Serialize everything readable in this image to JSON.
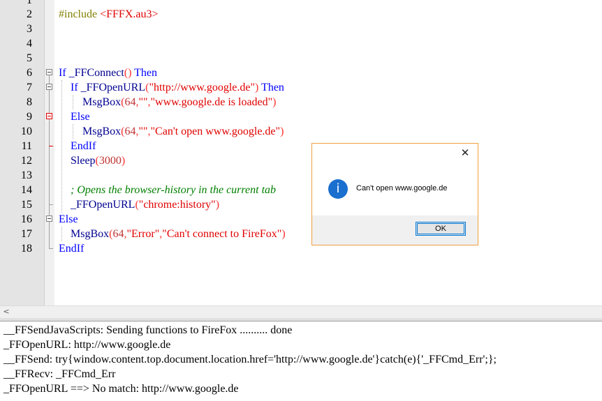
{
  "editor": {
    "line_numbers": [
      "1",
      "2",
      "3",
      "4",
      "5",
      "6",
      "7",
      "8",
      "9",
      "10",
      "11",
      "12",
      "13",
      "14",
      "15",
      "16",
      "17",
      "18"
    ],
    "code": {
      "l2_directive": "#include ",
      "l2_include": "<FFFX.au3>",
      "l6_if": "If ",
      "l6_fn": "_FFConnect",
      "l6_parens": "()",
      "l6_then": " Then",
      "l7_if": "If ",
      "l7_fn": "_FFOpenURL",
      "l7_open": "(",
      "l7_str": "\"http://www.google.de\"",
      "l7_close": ")",
      "l7_then": " Then",
      "l8_fn": "MsgBox",
      "l8_open": "(",
      "l8_num": "64",
      "l8_comma1": ",",
      "l8_str1": "\"\"",
      "l8_comma2": ",",
      "l8_str2": "\"www.google.de is loaded\"",
      "l8_close": ")",
      "l9_else": "Else",
      "l10_fn": "MsgBox",
      "l10_open": "(",
      "l10_num": "64",
      "l10_comma1": ",",
      "l10_str1": "\"\"",
      "l10_comma2": ",",
      "l10_str2": "\"Can't open www.google.de\"",
      "l10_close": ")",
      "l11_endif": "EndIf",
      "l12_fn": "Sleep",
      "l12_open": "(",
      "l12_num": "3000",
      "l12_close": ")",
      "l14_comment": "; Opens the browser-history in the current tab",
      "l15_fn": "_FFOpenURL",
      "l15_open": "(",
      "l15_str": "\"chrome:history\"",
      "l15_close": ")",
      "l16_else": "Else",
      "l17_fn": "MsgBox",
      "l17_open": "(",
      "l17_num": "64",
      "l17_comma1": ",",
      "l17_str1": "\"Error\"",
      "l17_comma2": ",",
      "l17_str2": "\"Can't connect to FireFox\"",
      "l17_close": ")",
      "l18_endif": "EndIf"
    }
  },
  "scrollbar": {
    "left_arrow": "<"
  },
  "console": {
    "lines": [
      "__FFSendJavaScripts: Sending functions to FireFox .......... done",
      "_FFOpenURL: http://www.google.de",
      "__FFSend: try{window.content.top.document.location.href='http://www.google.de'}catch(e){'_FFCmd_Err';};",
      "__FFRecv: _FFCmd_Err",
      "_FFOpenURL ==> No match: http://www.google.de"
    ]
  },
  "dialog": {
    "close_glyph": "✕",
    "icon": "information-icon",
    "icon_glyph": "i",
    "message": "Can't open www.google.de",
    "ok_label": "OK",
    "border_color": "#f0a040",
    "icon_color": "#1a6fcf"
  }
}
